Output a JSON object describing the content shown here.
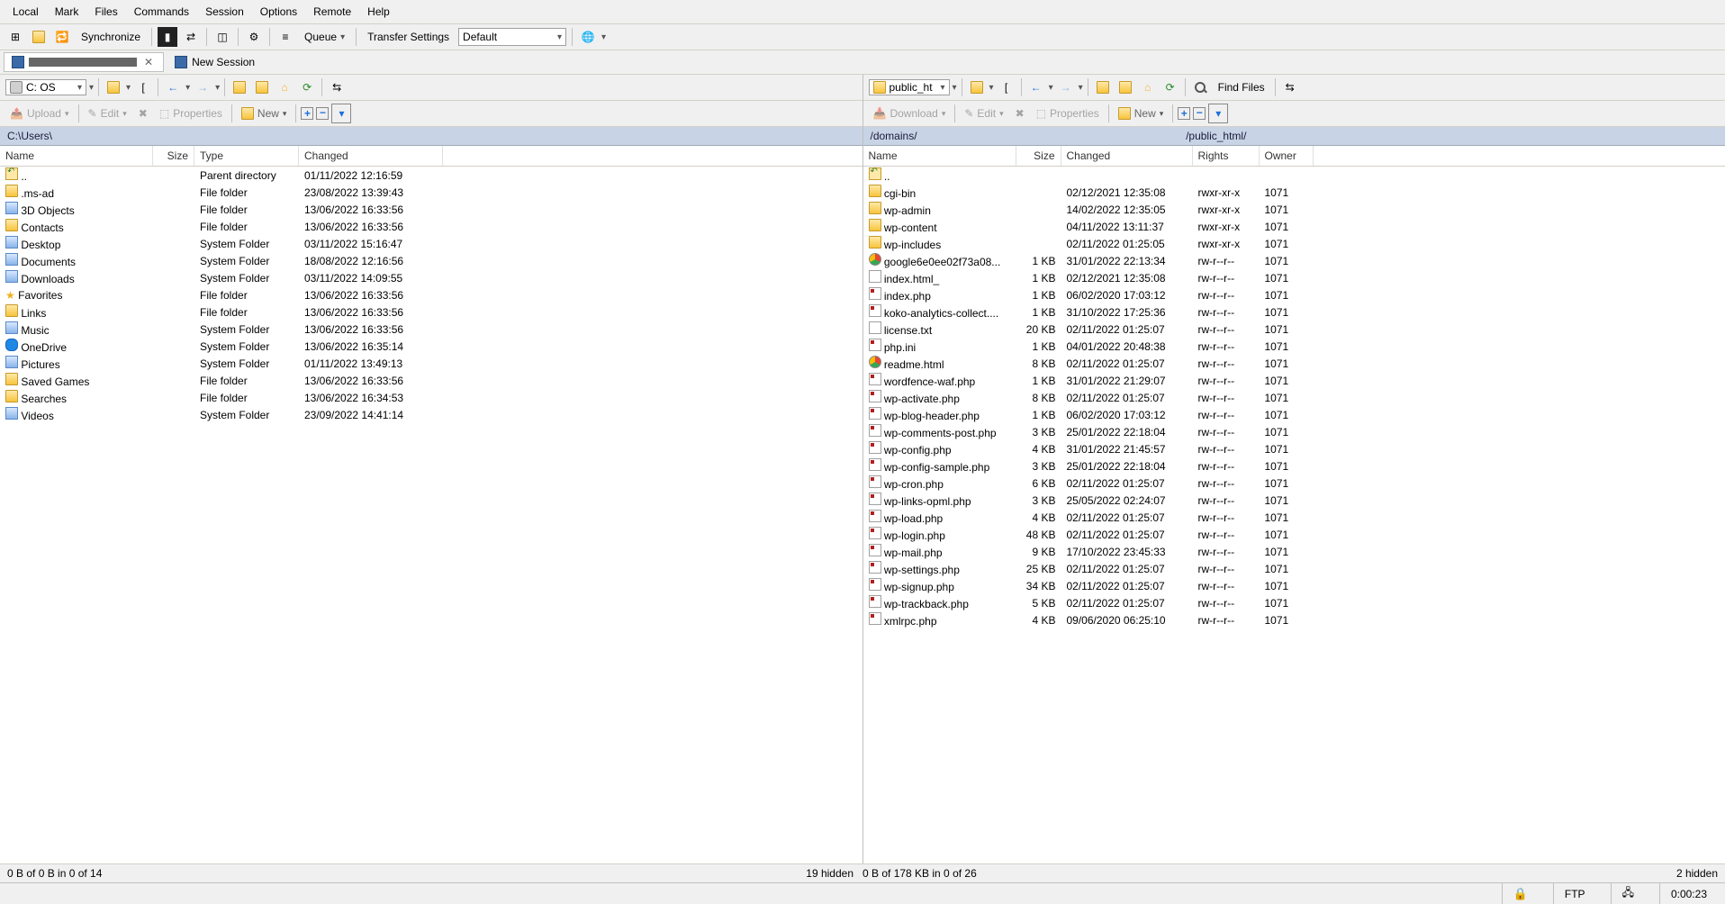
{
  "menu": [
    "Local",
    "Mark",
    "Files",
    "Commands",
    "Session",
    "Options",
    "Remote",
    "Help"
  ],
  "toolbar1": {
    "sync": "Synchronize",
    "queue": "Queue",
    "ts_label": "Transfer Settings",
    "ts_value": "Default"
  },
  "tabs": {
    "active": "",
    "new": "New Session"
  },
  "leftNav": {
    "drive": "C: OS"
  },
  "rightNav": {
    "drive": "public_ht",
    "find": "Find Files"
  },
  "actions": {
    "upload": "Upload",
    "download": "Download",
    "edit": "Edit",
    "props": "Properties",
    "new": "New"
  },
  "leftPath": "C:\\Users\\",
  "rightPath": {
    "a": "/domains/",
    "b": "/public_html/"
  },
  "leftCols": [
    "Name",
    "Size",
    "Type",
    "Changed"
  ],
  "rightCols": [
    "Name",
    "Size",
    "Changed",
    "Rights",
    "Owner"
  ],
  "leftFiles": [
    {
      "ic": "up",
      "name": "..",
      "size": "",
      "type": "Parent directory",
      "chg": "01/11/2022  12:16:59"
    },
    {
      "ic": "folder",
      "name": ".ms-ad",
      "size": "",
      "type": "File folder",
      "chg": "23/08/2022  13:39:43"
    },
    {
      "ic": "sys",
      "name": "3D Objects",
      "size": "",
      "type": "File folder",
      "chg": "13/06/2022  16:33:56"
    },
    {
      "ic": "folder",
      "name": "Contacts",
      "size": "",
      "type": "File folder",
      "chg": "13/06/2022  16:33:56"
    },
    {
      "ic": "sys",
      "name": "Desktop",
      "size": "",
      "type": "System Folder",
      "chg": "03/11/2022  15:16:47"
    },
    {
      "ic": "sys",
      "name": "Documents",
      "size": "",
      "type": "System Folder",
      "chg": "18/08/2022  12:16:56"
    },
    {
      "ic": "sys",
      "name": "Downloads",
      "size": "",
      "type": "System Folder",
      "chg": "03/11/2022  14:09:55"
    },
    {
      "ic": "star",
      "name": "Favorites",
      "size": "",
      "type": "File folder",
      "chg": "13/06/2022  16:33:56"
    },
    {
      "ic": "folder",
      "name": "Links",
      "size": "",
      "type": "File folder",
      "chg": "13/06/2022  16:33:56"
    },
    {
      "ic": "sys",
      "name": "Music",
      "size": "",
      "type": "System Folder",
      "chg": "13/06/2022  16:33:56"
    },
    {
      "ic": "cloud",
      "name": "OneDrive",
      "size": "",
      "type": "System Folder",
      "chg": "13/06/2022  16:35:14"
    },
    {
      "ic": "sys",
      "name": "Pictures",
      "size": "",
      "type": "System Folder",
      "chg": "01/11/2022  13:49:13"
    },
    {
      "ic": "folder",
      "name": "Saved Games",
      "size": "",
      "type": "File folder",
      "chg": "13/06/2022  16:33:56"
    },
    {
      "ic": "folder",
      "name": "Searches",
      "size": "",
      "type": "File folder",
      "chg": "13/06/2022  16:34:53"
    },
    {
      "ic": "sys",
      "name": "Videos",
      "size": "",
      "type": "System Folder",
      "chg": "23/09/2022  14:41:14"
    }
  ],
  "rightFiles": [
    {
      "ic": "up",
      "name": "..",
      "size": "",
      "chg": "",
      "rights": "",
      "owner": ""
    },
    {
      "ic": "folder",
      "name": "cgi-bin",
      "size": "",
      "chg": "02/12/2021 12:35:08",
      "rights": "rwxr-xr-x",
      "owner": "1071"
    },
    {
      "ic": "folder",
      "name": "wp-admin",
      "size": "",
      "chg": "14/02/2022 12:35:05",
      "rights": "rwxr-xr-x",
      "owner": "1071"
    },
    {
      "ic": "folder",
      "name": "wp-content",
      "size": "",
      "chg": "04/11/2022 13:11:37",
      "rights": "rwxr-xr-x",
      "owner": "1071"
    },
    {
      "ic": "folder",
      "name": "wp-includes",
      "size": "",
      "chg": "02/11/2022 01:25:05",
      "rights": "rwxr-xr-x",
      "owner": "1071"
    },
    {
      "ic": "chrome",
      "name": "google6e0ee02f73a08...",
      "size": "1 KB",
      "chg": "31/01/2022 22:13:34",
      "rights": "rw-r--r--",
      "owner": "1071"
    },
    {
      "ic": "file",
      "name": "index.html_",
      "size": "1 KB",
      "chg": "02/12/2021 12:35:08",
      "rights": "rw-r--r--",
      "owner": "1071"
    },
    {
      "ic": "php",
      "name": "index.php",
      "size": "1 KB",
      "chg": "06/02/2020 17:03:12",
      "rights": "rw-r--r--",
      "owner": "1071"
    },
    {
      "ic": "php",
      "name": "koko-analytics-collect....",
      "size": "1 KB",
      "chg": "31/10/2022 17:25:36",
      "rights": "rw-r--r--",
      "owner": "1071"
    },
    {
      "ic": "file",
      "name": "license.txt",
      "size": "20 KB",
      "chg": "02/11/2022 01:25:07",
      "rights": "rw-r--r--",
      "owner": "1071"
    },
    {
      "ic": "php",
      "name": "php.ini",
      "size": "1 KB",
      "chg": "04/01/2022 20:48:38",
      "rights": "rw-r--r--",
      "owner": "1071"
    },
    {
      "ic": "chrome",
      "name": "readme.html",
      "size": "8 KB",
      "chg": "02/11/2022 01:25:07",
      "rights": "rw-r--r--",
      "owner": "1071"
    },
    {
      "ic": "php",
      "name": "wordfence-waf.php",
      "size": "1 KB",
      "chg": "31/01/2022 21:29:07",
      "rights": "rw-r--r--",
      "owner": "1071"
    },
    {
      "ic": "php",
      "name": "wp-activate.php",
      "size": "8 KB",
      "chg": "02/11/2022 01:25:07",
      "rights": "rw-r--r--",
      "owner": "1071"
    },
    {
      "ic": "php",
      "name": "wp-blog-header.php",
      "size": "1 KB",
      "chg": "06/02/2020 17:03:12",
      "rights": "rw-r--r--",
      "owner": "1071"
    },
    {
      "ic": "php",
      "name": "wp-comments-post.php",
      "size": "3 KB",
      "chg": "25/01/2022 22:18:04",
      "rights": "rw-r--r--",
      "owner": "1071"
    },
    {
      "ic": "php",
      "name": "wp-config.php",
      "size": "4 KB",
      "chg": "31/01/2022 21:45:57",
      "rights": "rw-r--r--",
      "owner": "1071"
    },
    {
      "ic": "php",
      "name": "wp-config-sample.php",
      "size": "3 KB",
      "chg": "25/01/2022 22:18:04",
      "rights": "rw-r--r--",
      "owner": "1071"
    },
    {
      "ic": "php",
      "name": "wp-cron.php",
      "size": "6 KB",
      "chg": "02/11/2022 01:25:07",
      "rights": "rw-r--r--",
      "owner": "1071"
    },
    {
      "ic": "php",
      "name": "wp-links-opml.php",
      "size": "3 KB",
      "chg": "25/05/2022 02:24:07",
      "rights": "rw-r--r--",
      "owner": "1071"
    },
    {
      "ic": "php",
      "name": "wp-load.php",
      "size": "4 KB",
      "chg": "02/11/2022 01:25:07",
      "rights": "rw-r--r--",
      "owner": "1071"
    },
    {
      "ic": "php",
      "name": "wp-login.php",
      "size": "48 KB",
      "chg": "02/11/2022 01:25:07",
      "rights": "rw-r--r--",
      "owner": "1071"
    },
    {
      "ic": "php",
      "name": "wp-mail.php",
      "size": "9 KB",
      "chg": "17/10/2022 23:45:33",
      "rights": "rw-r--r--",
      "owner": "1071"
    },
    {
      "ic": "php",
      "name": "wp-settings.php",
      "size": "25 KB",
      "chg": "02/11/2022 01:25:07",
      "rights": "rw-r--r--",
      "owner": "1071"
    },
    {
      "ic": "php",
      "name": "wp-signup.php",
      "size": "34 KB",
      "chg": "02/11/2022 01:25:07",
      "rights": "rw-r--r--",
      "owner": "1071"
    },
    {
      "ic": "php",
      "name": "wp-trackback.php",
      "size": "5 KB",
      "chg": "02/11/2022 01:25:07",
      "rights": "rw-r--r--",
      "owner": "1071"
    },
    {
      "ic": "php",
      "name": "xmlrpc.php",
      "size": "4 KB",
      "chg": "09/06/2020 06:25:10",
      "rights": "rw-r--r--",
      "owner": "1071"
    }
  ],
  "summary": {
    "leftL": "0 B of 0 B in 0 of 14",
    "leftR": "19 hidden",
    "rightL": "0 B of 178 KB in 0 of 26",
    "rightR": "2 hidden"
  },
  "status": {
    "proto": "FTP",
    "time": "0:00:23"
  }
}
